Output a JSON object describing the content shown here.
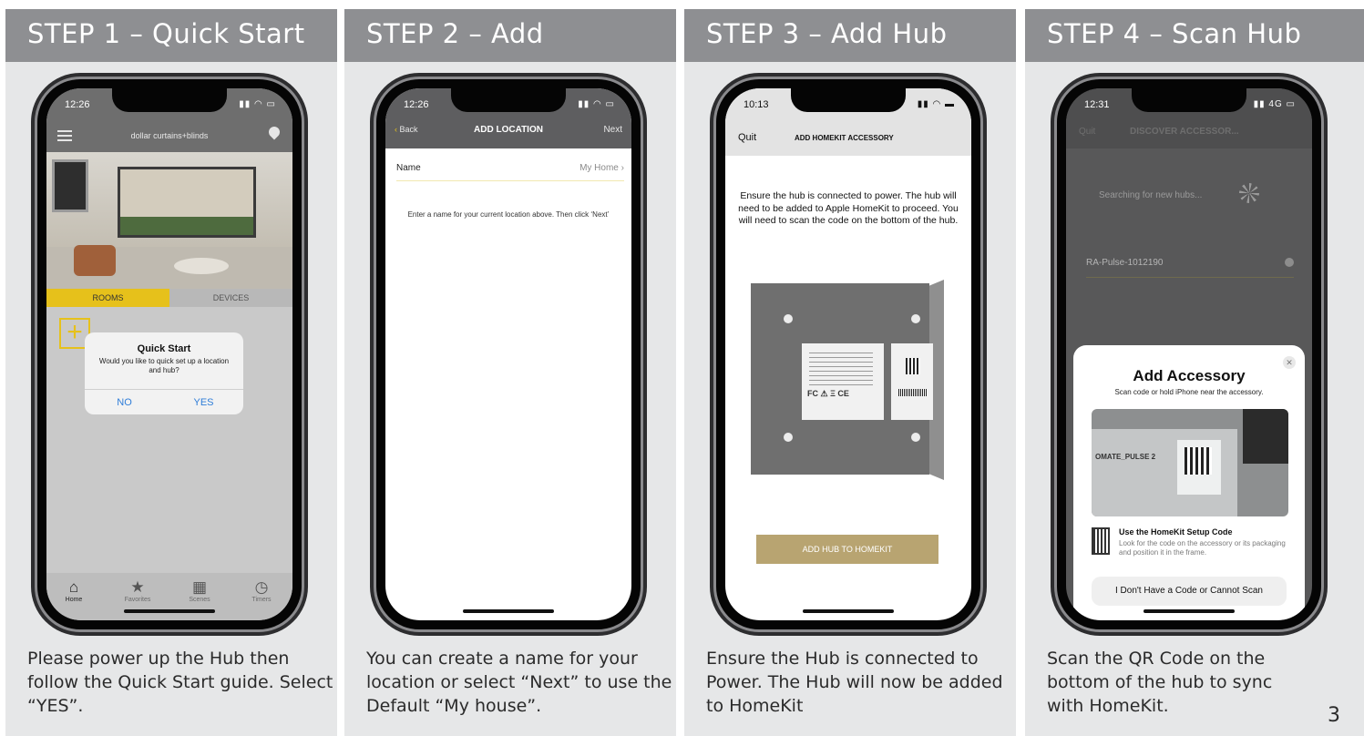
{
  "steps": [
    {
      "title": "STEP 1 – Quick Start",
      "caption": "Please power up the Hub then follow the Quick Start guide. Select “YES”.",
      "phone": {
        "time": "12:26",
        "brand": "dollar curtains+blinds",
        "tabs": [
          "ROOMS",
          "DEVICES"
        ],
        "dialog": {
          "title": "Quick Start",
          "message": "Would you like to quick set up a location and hub?",
          "no": "NO",
          "yes": "YES"
        },
        "tabbar": [
          {
            "label": "Home",
            "icon": "home-icon"
          },
          {
            "label": "Favorites",
            "icon": "star-icon"
          },
          {
            "label": "Scenes",
            "icon": "film-icon"
          },
          {
            "label": "Timers",
            "icon": "clock-icon"
          }
        ]
      }
    },
    {
      "title": "STEP 2 – Add",
      "caption": "You can create a name for your location or select “Next” to use the Default “My house”.",
      "phone": {
        "time": "12:26",
        "back": "Back",
        "nav_title": "ADD LOCATION",
        "next": "Next",
        "name_label": "Name",
        "name_value": "My Home",
        "hint": "Enter a name for your current location above. Then click ‘Next’"
      }
    },
    {
      "title": "STEP 3 – Add Hub",
      "caption": "Ensure the Hub is connected to Power. The Hub will now be added to HomeKit",
      "phone": {
        "time": "10:13",
        "quit": "Quit",
        "nav_title": "ADD HOMEKIT ACCESSORY",
        "body": "Ensure the hub is connected to power. The hub will need to be added to Apple HomeKit to proceed. You will need to scan the code on the bottom of the hub.",
        "button": "ADD HUB TO HOMEKIT"
      }
    },
    {
      "title": "STEP 4 – Scan Hub",
      "caption": "Scan the QR Code on the bottom of the hub to sync with HomeKit.",
      "phone": {
        "time": "12:31",
        "network": "4G",
        "quit": "Quit",
        "nav_title": "DISCOVER ACCESSOR...",
        "searching": "Searching for new hubs...",
        "hub_name": "RA-Pulse-1012190",
        "sheet": {
          "title": "Add Accessory",
          "subtitle": "Scan code or hold iPhone near the accessory.",
          "camera_text": "OMATE_PULSE 2",
          "setup_title": "Use the HomeKit Setup Code",
          "setup_desc": "Look for the code on the accessory or its packaging and position it in the frame.",
          "no_code": "I Don't Have a Code or Cannot Scan"
        }
      }
    }
  ],
  "page_number": "3"
}
